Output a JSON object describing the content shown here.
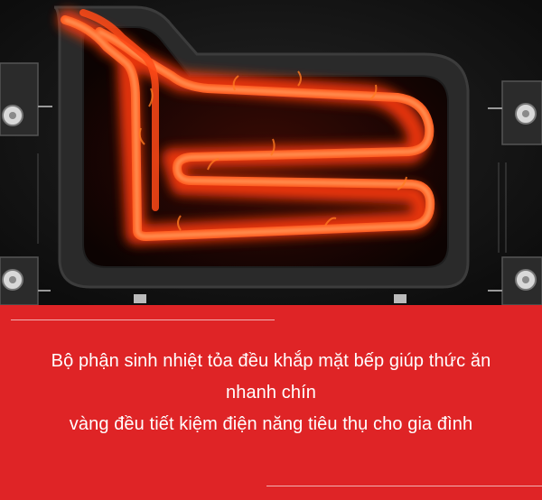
{
  "photo": {
    "alt_subject": "heating-element"
  },
  "caption": {
    "line1": "Bộ phận sinh nhiệt tỏa đều khắp mặt bếp giúp thức ăn",
    "line2": "nhanh chín",
    "line3": "vàng đều tiết kiệm điện năng tiêu thụ cho gia đình"
  },
  "colors": {
    "caption_background": "#df2426",
    "caption_text": "#ffffff",
    "heating_glow": "#ff4a1c",
    "cooktop_surface": "#141414"
  }
}
